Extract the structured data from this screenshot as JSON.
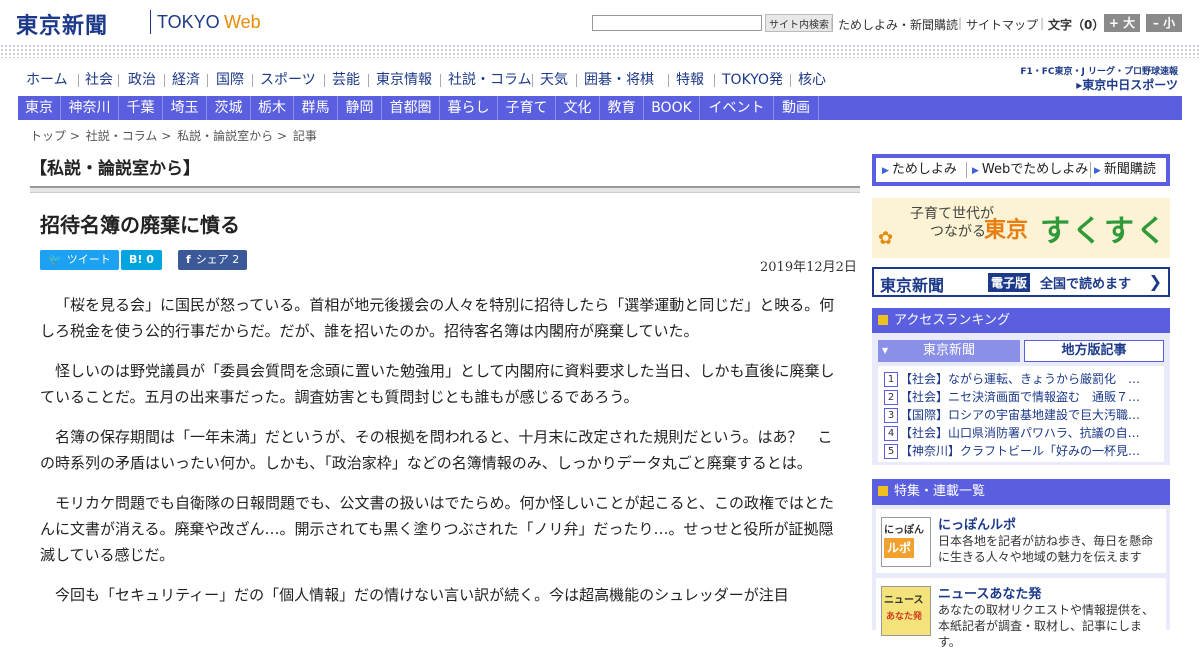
{
  "header": {
    "logo": "東京新聞",
    "logo_tokyo": "TOKYO",
    "logo_web": "Web",
    "search_button": "サイト内検索",
    "links": [
      "ためしよみ・新聞購読",
      "サイトマップ"
    ],
    "font_size_label": "文字（0）",
    "bigger_label": "+ 大",
    "smaller_label": "– 小"
  },
  "main_nav": [
    "ホーム",
    "社会",
    "政治",
    "経済",
    "国際",
    "スポーツ",
    "芸能",
    "東京情報",
    "社説・コラム",
    "天気",
    "囲碁・将棋",
    "特報",
    "TOKYO発",
    "核心"
  ],
  "chunichi": {
    "top": "F1・FC東京・J リーグ・プロ野球速報",
    "bottom": "▸東京中日スポーツ"
  },
  "sub_nav": [
    "東京",
    "神奈川",
    "千葉",
    "埼玉",
    "茨城",
    "栃木",
    "群馬",
    "静岡",
    "首都圏",
    "暮らし",
    "子育て",
    "文化",
    "教育",
    "BOOK",
    "イベント",
    "動画"
  ],
  "breadcrumb": [
    "トップ",
    ">",
    "社説・コラム",
    ">",
    "私説・論説室から",
    ">",
    "記事"
  ],
  "article": {
    "section": "【私説・論説室から】",
    "title": "招待名簿の廃棄に憤る",
    "date": "2019年12月2日",
    "share": {
      "tweet": "ツイート",
      "hatena": "B! 0",
      "facebook": "シェア 2"
    },
    "paragraphs": [
      "「桜を見る会」に国民が怒っている。首相が地元後援会の人々を特別に招待したら「選挙運動と同じだ」と映る。何しろ税金を使う公的行事だからだ。だが、誰を招いたのか。招待客名簿は内閣府が廃棄していた。",
      "怪しいのは野党議員が「委員会質問を念頭に置いた勉強用」として内閣府に資料要求した当日、しかも直後に廃棄していることだ。五月の出来事だった。調査妨害とも質問封じとも誰もが感じるであろう。",
      "名簿の保存期間は「一年未満」だというが、その根拠を問われると、十月末に改定された規則だという。はあ？　この時系列の矛盾はいったい何か。しかも、「政治家枠」などの名簿情報のみ、しっかりデータ丸ごと廃棄するとは。",
      "モリカケ問題でも自衛隊の日報問題でも、公文書の扱いはでたらめ。何か怪しいことが起こると、この政権ではとたんに文書が消える。廃棄や改ざん…。開示されても黒く塗りつぶされた「ノリ弁」だったり…。せっせと役所が証拠隠滅している感じだ。",
      "今回も「セキュリティー」だの「個人情報」だの情けない言い訳が続く。今は超高機能のシュレッダーが注目"
    ]
  },
  "sidebar": {
    "tameshi": [
      "ためしよみ",
      "Webでためしよみ",
      "新聞購読"
    ],
    "sukusuku": {
      "line1": "子育て世代が",
      "line2": "つながる",
      "tokyo": "東京",
      "main": "すくすく"
    },
    "denshiban": {
      "logo": "東京新聞",
      "badge": "電子版",
      "text": "全国で読めます"
    },
    "ranking": {
      "heading": "アクセスランキング",
      "tab_active": "東京新聞",
      "tab_inactive": "地方版記事",
      "items": [
        "【社会】ながら運転、きょうから厳罰化　…",
        "【社会】ニセ決済画面で情報盗む　通販７…",
        "【国際】ロシアの宇宙基地建設で巨大汚職…",
        "【社会】山口県消防署パワハラ、抗議の自…",
        "【神奈川】クラフトビール「好みの一杯見…"
      ]
    },
    "features": {
      "heading": "特集・連載一覧",
      "items": [
        {
          "title": "にっぽんルポ",
          "desc": "日本各地を記者が訪ね歩き、毎日を懸命に生きる人々や地域の魅力を伝えます",
          "img_top": "にっぽん",
          "img_bottom": "ルポ"
        },
        {
          "title": "ニュースあなた発",
          "desc": "あなたの取材リクエストや情報提供を、本紙記者が調査・取材し、記事にします。",
          "img_top": "ニュース",
          "img_bottom": "あなた発"
        }
      ]
    }
  },
  "colors": {
    "brand": "#1d3a8a",
    "nav_bar": "#5a5fe0",
    "accent_orange": "#e98a00"
  }
}
